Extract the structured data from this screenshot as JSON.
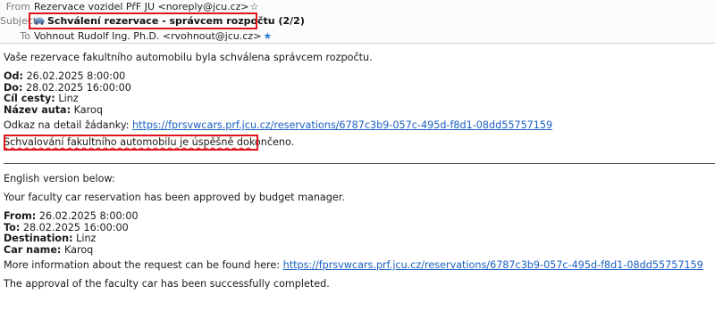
{
  "header": {
    "from_label": "From",
    "from_value": "Rezervace vozidel PřF JU <noreply@jcu.cz>",
    "subject_label": "Subject",
    "subject_value": "Schválení rezervace - správcem rozpočtu (2/2)",
    "to_label": "To",
    "to_value": "Vohnout Rudolf Ing. Ph.D. <rvohnout@jcu.cz>",
    "subject_icon": "car-icon",
    "from_star": "star-outline-icon",
    "to_star": "star-filled-icon"
  },
  "czech": {
    "intro": "Vaše rezervace fakultního automobilu byla schválena správcem rozpočtu.",
    "od_label": "Od:",
    "od_value": "26.02.2025 8:00:00",
    "do_label": "Do:",
    "do_value": "28.02.2025 16:00:00",
    "cil_label": "Cíl cesty:",
    "cil_value": "Linz",
    "auto_label": "Název auta:",
    "auto_value": "Karoq",
    "detail_prefix": "Odkaz na detail žádanky:",
    "detail_link": "https://fprsvwcars.prf.jcu.cz/reservations/6787c3b9-057c-495d-f8d1-08dd55757159",
    "done": "Schvalování fakultního automobilu je úspěšně dokončeno."
  },
  "english": {
    "heading": "English version below:",
    "intro": "Your faculty car reservation has been approved by budget manager.",
    "from_label": "From:",
    "from_value": "26.02.2025 8:00:00",
    "to_label": "To:",
    "to_value": "28.02.2025 16:00:00",
    "dest_label": "Destination:",
    "dest_value": "Linz",
    "car_label": "Car name:",
    "car_value": "Karoq",
    "more_prefix": "More information about the request can be found here:",
    "more_link": "https://fprsvwcars.prf.jcu.cz/reservations/6787c3b9-057c-495d-f8d1-08dd55757159",
    "done": "The approval of the faculty car has been successfully completed."
  },
  "colors": {
    "highlight": "#e0151b",
    "link": "#1a5fc4",
    "star_blue": "#2a7bd4"
  }
}
